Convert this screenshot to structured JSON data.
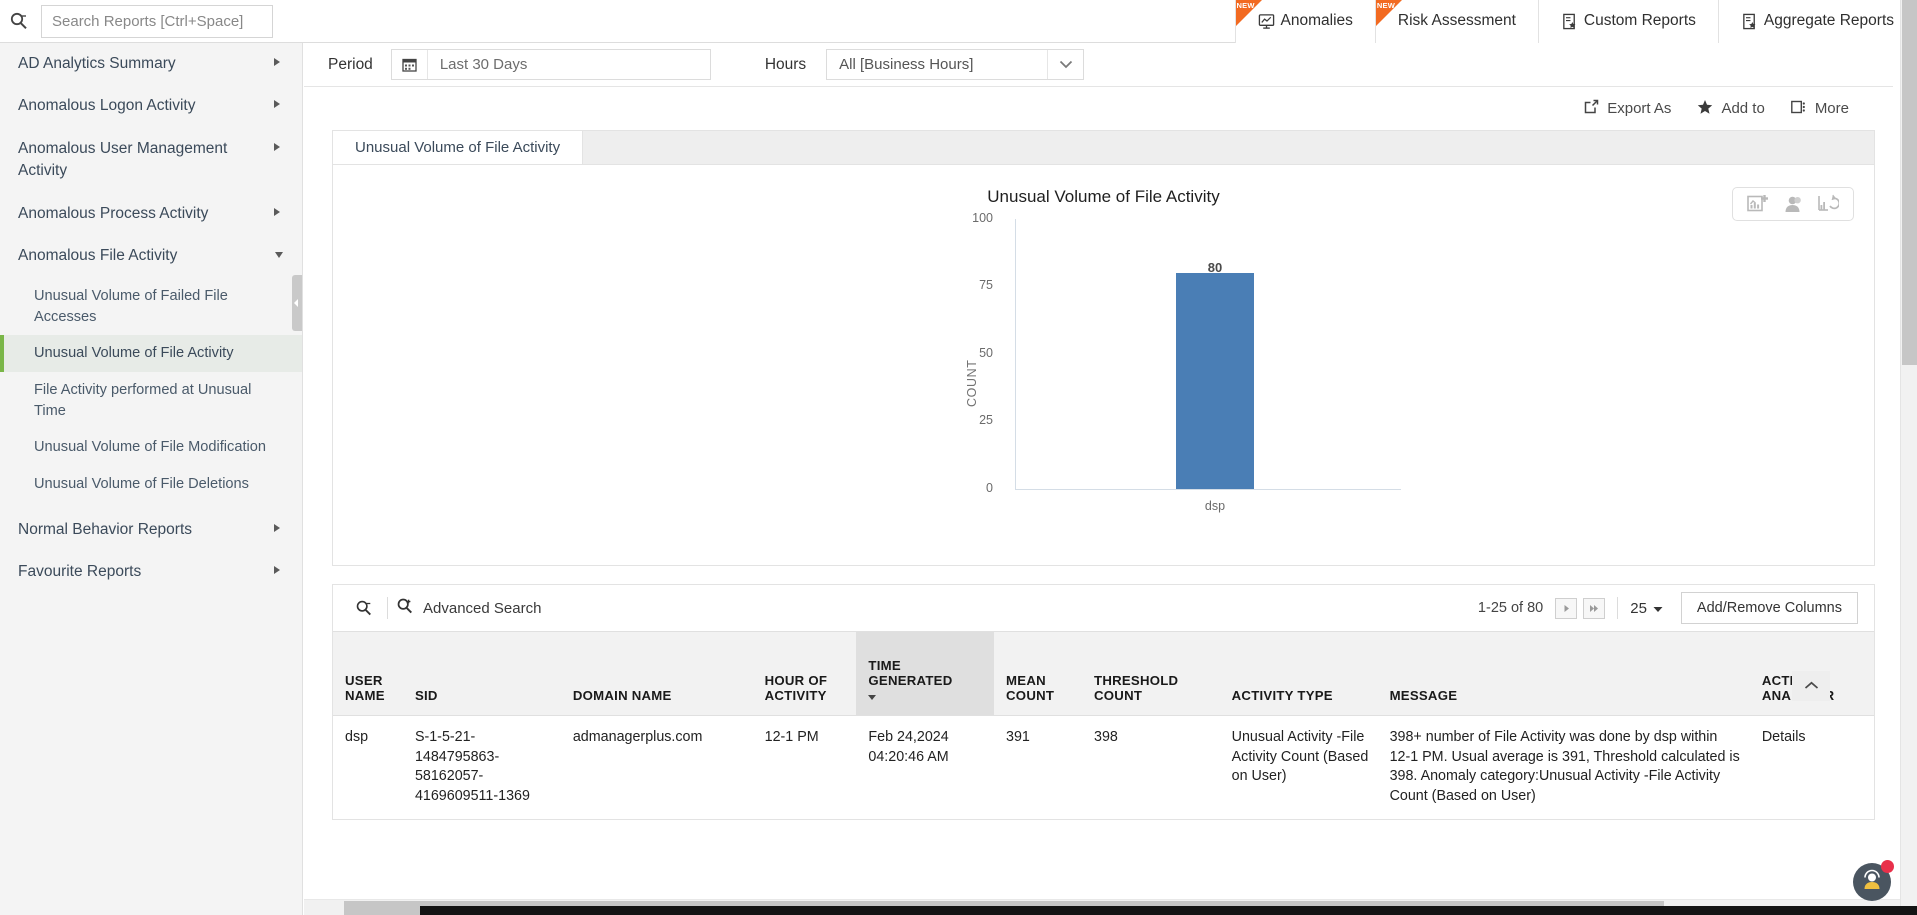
{
  "topbar": {
    "search_placeholder": "Search Reports [Ctrl+Space]",
    "search_value": "",
    "search_icon": "search-icon",
    "tabs": [
      {
        "label": "Anomalies",
        "badge": "NEW",
        "icon": "anomalies-chart-icon",
        "new": true
      },
      {
        "label": "Risk Assessment",
        "badge": "NEW",
        "icon": "",
        "new": true
      },
      {
        "label": "Custom Reports",
        "badge": "",
        "icon": "report-star-icon",
        "new": false
      },
      {
        "label": "Aggregate Reports",
        "badge": "",
        "icon": "report-star-icon",
        "new": false
      }
    ]
  },
  "sidebar": {
    "items": [
      {
        "label": "AD Analytics Summary",
        "expandable": true,
        "expanded": false
      },
      {
        "label": "Anomalous Logon Activity",
        "expandable": true,
        "expanded": false
      },
      {
        "label": "Anomalous User Management Activity",
        "expandable": true,
        "expanded": false
      },
      {
        "label": "Anomalous Process Activity",
        "expandable": true,
        "expanded": false
      },
      {
        "label": "Anomalous File Activity",
        "expandable": true,
        "expanded": true
      }
    ],
    "sub_items": [
      {
        "label": "Unusual Volume of Failed File Accesses",
        "active": false
      },
      {
        "label": "Unusual Volume of File Activity",
        "active": true
      },
      {
        "label": "File Activity performed at Unusual Time",
        "active": false
      },
      {
        "label": "Unusual Volume of File Modification",
        "active": false
      },
      {
        "label": "Unusual Volume of File Deletions",
        "active": false
      }
    ],
    "bottom_items": [
      {
        "label": "Normal Behavior Reports",
        "expandable": true,
        "expanded": false
      },
      {
        "label": "Favourite Reports",
        "expandable": true,
        "expanded": false
      }
    ]
  },
  "filters": {
    "period_label": "Period",
    "period_value": "Last 30 Days",
    "period_icon": "calendar-icon",
    "hours_label": "Hours",
    "hours_value": "All [Business Hours]",
    "hours_arrow_icon": "chevron-down-icon"
  },
  "actions": [
    {
      "label": "Export As",
      "icon": "export-icon"
    },
    {
      "label": "Add to",
      "icon": "star-icon"
    },
    {
      "label": "More",
      "icon": "more-icon"
    }
  ],
  "report": {
    "tab_label": "Unusual Volume of File Activity",
    "chart_tools": [
      {
        "name": "add-chart-icon"
      },
      {
        "name": "user-icon"
      },
      {
        "name": "refresh-chart-icon"
      }
    ]
  },
  "chart_data": {
    "type": "bar",
    "title": "Unusual Volume of File Activity",
    "categories": [
      "dsp"
    ],
    "values": [
      80
    ],
    "data_labels": [
      "80"
    ],
    "xlabel": "",
    "ylabel": "COUNT",
    "ylim": [
      0,
      100
    ],
    "yticks": [
      100,
      75,
      50,
      25,
      0
    ],
    "grid": false,
    "bar_color": "#4a7eb5",
    "legend": "none"
  },
  "table_toolbar": {
    "search_icon": "search-icon",
    "advanced_search_icon": "advanced-search-icon",
    "advanced_search_label": "Advanced Search",
    "page_range": "1-25 of 80",
    "next_icon": "next-page-icon",
    "last_icon": "last-page-icon",
    "page_size": "25",
    "page_size_caret": "caret-down-icon",
    "add_remove_columns_label": "Add/Remove Columns",
    "scroll_top_icon": "chevron-up-icon"
  },
  "table": {
    "columns": [
      {
        "label": "USER NAME",
        "sorted": false
      },
      {
        "label": "SID",
        "sorted": false
      },
      {
        "label": "DOMAIN NAME",
        "sorted": false
      },
      {
        "label": "HOUR OF ACTIVITY",
        "sorted": false
      },
      {
        "label": "TIME GENERATED",
        "sorted": true
      },
      {
        "label": "MEAN COUNT",
        "sorted": false
      },
      {
        "label": "THRESHOLD COUNT",
        "sorted": false
      },
      {
        "label": "ACTIVITY TYPE",
        "sorted": false
      },
      {
        "label": "MESSAGE",
        "sorted": false
      },
      {
        "label": "ACTIVITY ANALYZER",
        "sorted": false
      }
    ],
    "rows": [
      {
        "user_name": "dsp",
        "sid": "S-1-5-21-1484795863-58162057-4169609511-1369",
        "domain_name": "admanagerplus.com",
        "hour_of_activity": "12-1 PM",
        "time_generated": "Feb 24,2024 04:20:46 AM",
        "mean_count": "391",
        "threshold_count": "398",
        "activity_type": "Unusual Activity -File Activity Count (Based on User)",
        "message": "398+ number of File Activity was done by dsp within 12-1 PM. Usual average is 391, Threshold calculated is 398. Anomaly category:Unusual Activity -File Activity Count (Based on User)",
        "activity_analyzer": "Details"
      }
    ]
  },
  "chat": {
    "icon": "support-chat-icon",
    "badge": ""
  },
  "colors": {
    "accent_green": "#7ab648",
    "ribbon_orange": "#f26a21",
    "bar_blue": "#4a7eb5",
    "link_blue": "#2b6cb0",
    "badge_red": "#e8304a"
  }
}
